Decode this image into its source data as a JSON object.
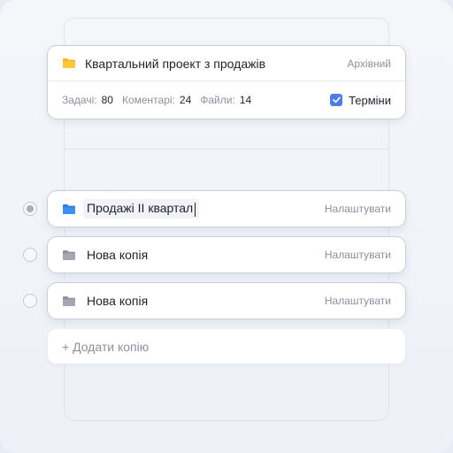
{
  "project": {
    "title": "Квартальний проект з продажів",
    "status": "Архівний",
    "stats": [
      {
        "label": "Задачі:",
        "value": "80"
      },
      {
        "label": "Коментарі:",
        "value": "24"
      },
      {
        "label": "Файли:",
        "value": "14"
      }
    ],
    "terms_label": "Терміни",
    "terms_checked": true
  },
  "copies": [
    {
      "name": "Продажі II квартал",
      "action": "Налаштувати",
      "selected": true,
      "editing": true,
      "folder_color": "#3f8ef0"
    },
    {
      "name": "Нова копія",
      "action": "Налаштувати",
      "selected": false,
      "editing": false,
      "folder_color": "#9ca1a9"
    },
    {
      "name": "Нова копія",
      "action": "Налаштувати",
      "selected": false,
      "editing": false,
      "folder_color": "#9ca1a9"
    }
  ],
  "add_copy_label": "+ Додати копію",
  "colors": {
    "accent": "#4e7fe0",
    "project_folder": "#f5b51e"
  }
}
